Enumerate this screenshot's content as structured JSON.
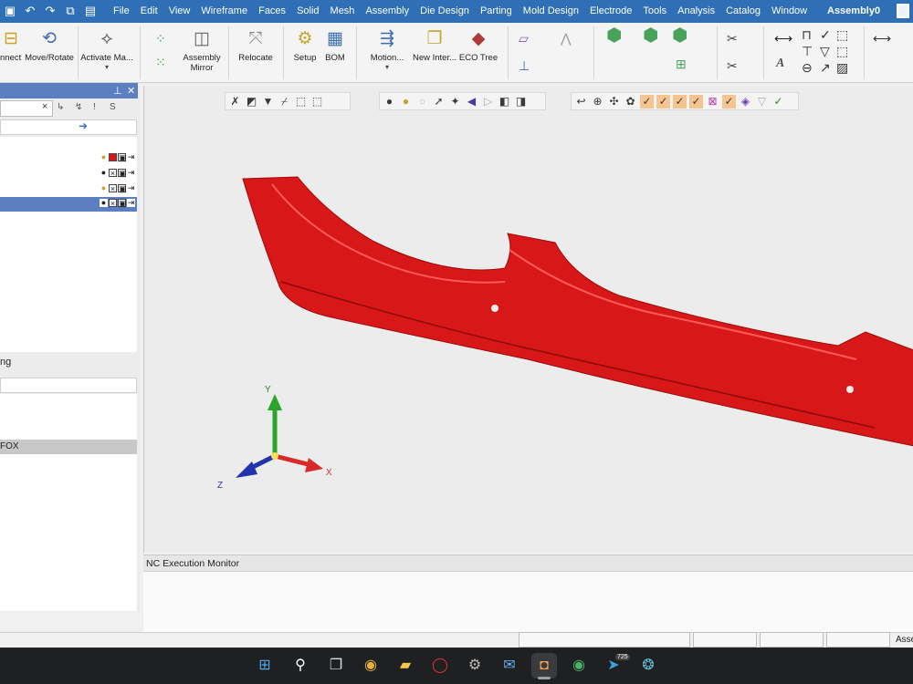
{
  "window": {
    "title": "Assembly0"
  },
  "menu": [
    "File",
    "Edit",
    "View",
    "Wireframe",
    "Faces",
    "Solid",
    "Mesh",
    "Assembly",
    "Die Design",
    "Parting",
    "Mold Design",
    "Electrode",
    "Tools",
    "Analysis",
    "Catalog",
    "Window"
  ],
  "ribbon": {
    "connect": "nnect",
    "move_rotate": "Move/Rotate",
    "activate": "Activate Ma...",
    "assembly_mirror_1": "Assembly",
    "assembly_mirror_2": "Mirror",
    "relocate": "Relocate",
    "setup": "Setup",
    "bom": "BOM",
    "motion": "Motion...",
    "new_inter": "New Inter...",
    "eco_tree": "ECO Tree"
  },
  "left_panel": {
    "search_value": "",
    "columns": [
      "↳",
      "↯",
      "!",
      "S"
    ],
    "split_label": "ng",
    "selected_item": "FOX"
  },
  "triad": {
    "x": "X",
    "y": "Y",
    "z": "Z"
  },
  "nc_monitor": {
    "title": "NC Execution Monitor"
  },
  "status": {
    "text": "Asse"
  },
  "taskbar": {
    "telegram_badge": "725"
  },
  "colors": {
    "accent": "#2f6fb5",
    "part": "#d81818",
    "selection": "#5b7fc0"
  }
}
